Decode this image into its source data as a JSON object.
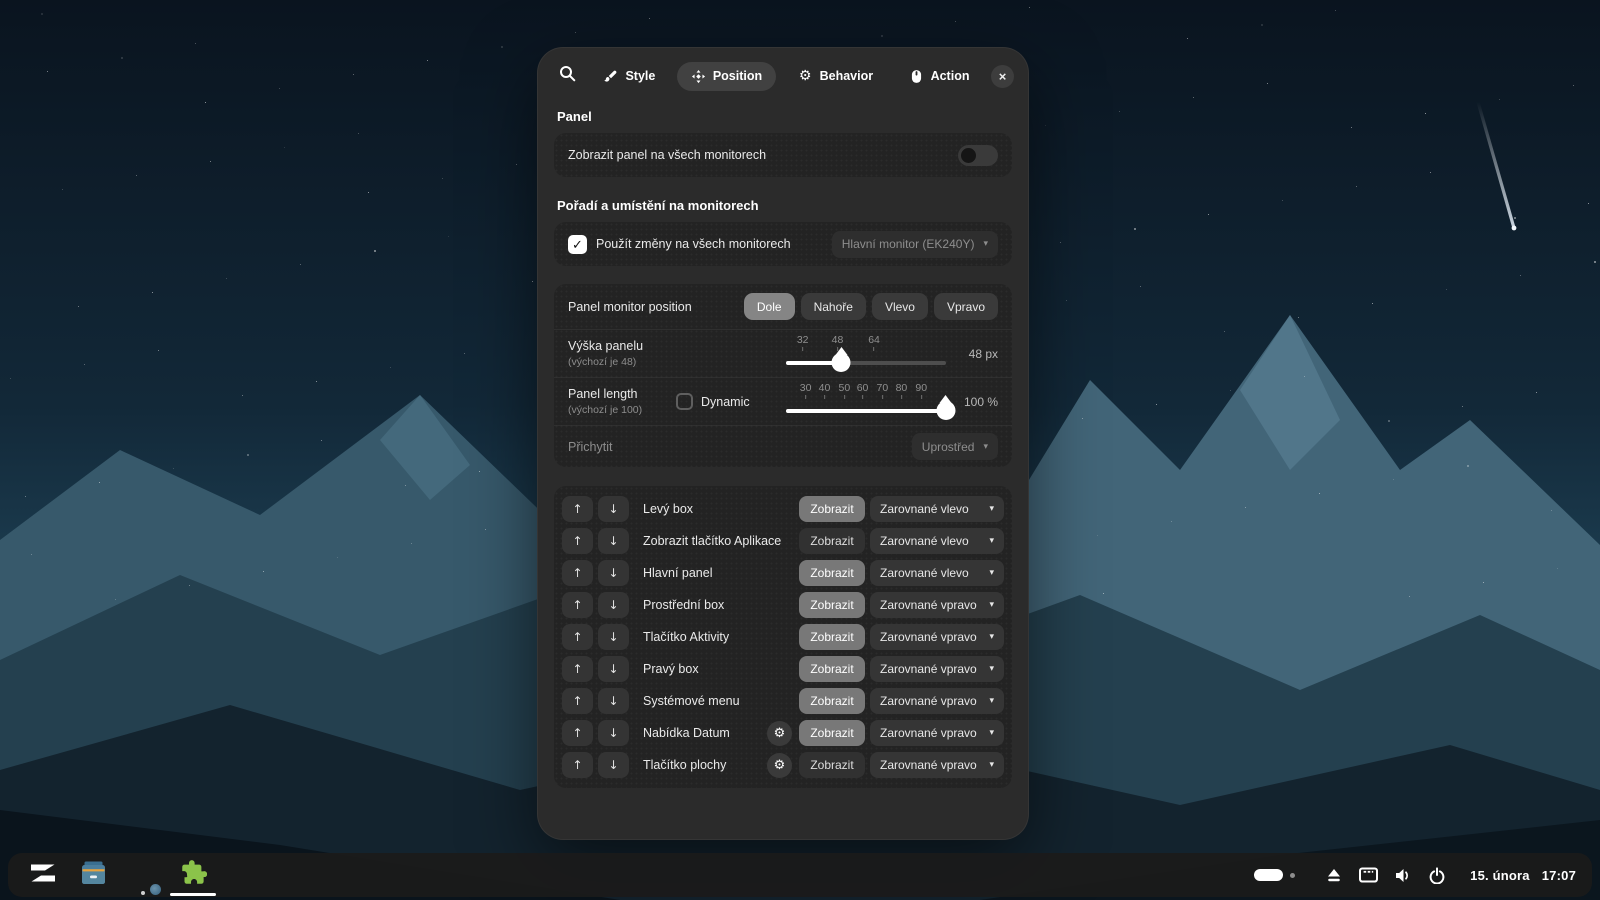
{
  "icons": {
    "up": "↑",
    "down": "↓",
    "chevron": "▾",
    "check": "✓",
    "gear": "⚙",
    "close": "×"
  },
  "colors": {
    "dialog_bg": "#2b2b2b",
    "card_bg": "#232323",
    "accent_selected": "#858585",
    "taskbar_bg": "#1b1b1b"
  },
  "dialog": {
    "header": {
      "tabs": [
        {
          "label": "Style",
          "icon": "brush",
          "selected": false
        },
        {
          "label": "Position",
          "icon": "move",
          "selected": true
        },
        {
          "label": "Behavior",
          "icon": "gear",
          "selected": false
        },
        {
          "label": "Action",
          "icon": "mouse",
          "selected": false
        }
      ]
    },
    "panel_section": {
      "heading": "Panel",
      "show_all_monitors": {
        "label": "Zobrazit panel na všech monitorech",
        "enabled": false
      }
    },
    "order_section": {
      "heading": "Pořadí a umístění na monitorech",
      "apply_all": {
        "label": "Použít změny na všech monitorech",
        "checked": true
      },
      "monitor_select": {
        "value": "Hlavní monitor (EK240Y)",
        "disabled": true
      },
      "monitor_position": {
        "label": "Panel monitor position",
        "options": [
          "Dole",
          "Nahoře",
          "Vlevo",
          "Vpravo"
        ],
        "selected": "Dole"
      },
      "panel_height": {
        "label": "Výška panelu",
        "sublabel": "(výchozí je 48)",
        "ticks": [
          {
            "label": "32",
            "pct": 11.4
          },
          {
            "label": "48",
            "pct": 32.6
          },
          {
            "label": "64",
            "pct": 54.9
          }
        ],
        "handle_pct": 33.7,
        "value": "48 px"
      },
      "panel_length": {
        "label": "Panel length",
        "sublabel": "(výchozí je 100)",
        "dynamic": {
          "label": "Dynamic",
          "checked": false
        },
        "ticks": [
          {
            "label": "30",
            "pct": 13.2
          },
          {
            "label": "40",
            "pct": 24.7
          },
          {
            "label": "50",
            "pct": 36.8
          },
          {
            "label": "60",
            "pct": 47.9
          },
          {
            "label": "70",
            "pct": 60.0
          },
          {
            "label": "80",
            "pct": 71.6
          },
          {
            "label": "90",
            "pct": 83.7
          }
        ],
        "handle_pct": 97.4,
        "value": "100 %"
      },
      "anchor": {
        "label": "Přichytit",
        "value": "Uprostřed",
        "disabled": true
      }
    },
    "elements_section": {
      "visibility_label": "Zobrazit",
      "rows": [
        {
          "label": "Levý box",
          "align": "Zarovnané vlevo",
          "visible": true,
          "gear": false
        },
        {
          "label": "Zobrazit tlačítko Aplikace",
          "align": "Zarovnané vlevo",
          "visible": false,
          "gear": false
        },
        {
          "label": "Hlavní panel",
          "align": "Zarovnané vlevo",
          "visible": true,
          "gear": false
        },
        {
          "label": "Prostřední box",
          "align": "Zarovnané vpravo",
          "visible": true,
          "gear": false
        },
        {
          "label": "Tlačítko Aktivity",
          "align": "Zarovnané vpravo",
          "visible": true,
          "gear": false
        },
        {
          "label": "Pravý box",
          "align": "Zarovnané vpravo",
          "visible": true,
          "gear": false
        },
        {
          "label": "Systémové menu",
          "align": "Zarovnané vpravo",
          "visible": true,
          "gear": false
        },
        {
          "label": "Nabídka Datum",
          "align": "Zarovnané vpravo",
          "visible": true,
          "gear": true
        },
        {
          "label": "Tlačítko plochy",
          "align": "Zarovnané vpravo",
          "visible": false,
          "gear": true
        }
      ]
    }
  },
  "taskbar": {
    "apps": [
      {
        "name": "zorin-menu",
        "indicator": "none"
      },
      {
        "name": "files",
        "indicator": "none"
      },
      {
        "name": "firefox",
        "indicator": "dot"
      },
      {
        "name": "extensions",
        "indicator": "line"
      }
    ],
    "clock": {
      "date": "15. února",
      "time": "17:07"
    }
  }
}
